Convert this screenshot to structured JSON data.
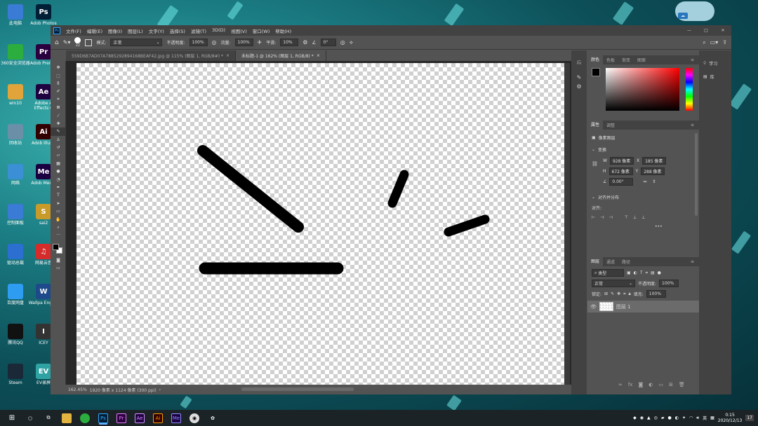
{
  "desktop": {
    "icons_col1": [
      {
        "label": "此电脑",
        "icon": "computer-icon",
        "color": "#3a7bd5"
      },
      {
        "label": "360安全浏览器",
        "icon": "browser-360-icon",
        "color": "#2cae3f"
      },
      {
        "label": "win10",
        "icon": "folder-user-icon",
        "color": "#e0a43a"
      },
      {
        "label": "回收站",
        "icon": "recycle-bin-icon",
        "color": "#6c8fa8"
      },
      {
        "label": "网络",
        "icon": "network-icon",
        "color": "#3a8fd5"
      },
      {
        "label": "控制面板",
        "icon": "control-panel-icon",
        "color": "#3a7bd5"
      },
      {
        "label": "驱动总裁",
        "icon": "driver-icon",
        "color": "#2b6fd1"
      },
      {
        "label": "百度网盘",
        "icon": "baidu-netdisk-icon",
        "color": "#2e9cf0"
      },
      {
        "label": "腾讯QQ",
        "icon": "qq-icon",
        "color": "#111"
      },
      {
        "label": "Steam",
        "icon": "steam-icon",
        "color": "#1b2838"
      }
    ],
    "icons_col2": [
      {
        "label": "Adob Photos",
        "icon": "photoshop-icon",
        "color": "#001e36",
        "glyph": "Ps"
      },
      {
        "label": "Adob Premie",
        "icon": "premiere-icon",
        "color": "#2a003f",
        "glyph": "Pr"
      },
      {
        "label": "Adobe A Effects C",
        "icon": "after-effects-icon",
        "color": "#1f0040",
        "glyph": "Ae"
      },
      {
        "label": "Adob Illustr",
        "icon": "illustrator-icon",
        "color": "#330000",
        "glyph": "Ai"
      },
      {
        "label": "Adob Media",
        "icon": "media-encoder-icon",
        "color": "#1a0040",
        "glyph": "Me"
      },
      {
        "label": "sai2",
        "icon": "sai-icon",
        "color": "#c79a2a",
        "glyph": "S"
      },
      {
        "label": "网易云音",
        "icon": "netease-music-icon",
        "color": "#d52b2b",
        "glyph": "♫"
      },
      {
        "label": "Wallpa Engine",
        "icon": "wallpaper-engine-icon",
        "color": "#1e4a8c",
        "glyph": "W"
      },
      {
        "label": "ICEY",
        "icon": "icey-icon",
        "color": "#333",
        "glyph": "I"
      },
      {
        "label": "EV录屏",
        "icon": "ev-recorder-icon",
        "color": "#2fa3a3",
        "glyph": "EV"
      }
    ]
  },
  "photoshop": {
    "app_icon": "Ps",
    "menu": [
      "文件(F)",
      "编辑(E)",
      "图像(I)",
      "图层(L)",
      "文字(Y)",
      "选择(S)",
      "滤镜(T)",
      "3D(D)",
      "视图(V)",
      "窗口(W)",
      "帮助(H)"
    ],
    "window_controls": [
      "—",
      "□",
      "✕"
    ],
    "options": {
      "brush_size": "22",
      "mode_label": "模式:",
      "mode_value": "正常",
      "opacity_label": "不透明度:",
      "opacity_value": "100%",
      "flow_label": "流量:",
      "flow_value": "100%",
      "smooth_label": "平滑:",
      "smooth_value": "10%",
      "angle_value": "0°"
    },
    "tabs": [
      {
        "label": "559D6B7AD07A7885292894168BEAF42.jpg @ 115% (图层 1, RGB/8#) *",
        "active": false
      },
      {
        "label": "未标题-1 @ 162% (图层 1, RGB/8) *",
        "active": true
      }
    ],
    "status": {
      "zoom": "162.45%",
      "doc_info": "1920 像素 x 1124 像素 (300 ppi)"
    },
    "color_panel": {
      "tabs": [
        "颜色",
        "色板",
        "渐变",
        "图案"
      ],
      "foreground": "#000000",
      "background": "#ffffff"
    },
    "properties_panel": {
      "tabs": [
        "属性",
        "调整"
      ],
      "type_label": "像素图层",
      "transform_title": "变换",
      "w_label": "W",
      "w_value": "928 像素",
      "h_label": "H",
      "h_value": "672 像素",
      "x_label": "X",
      "x_value": "185 像素",
      "y_label": "Y",
      "y_value": "288 像素",
      "angle_value": "0.00°",
      "align_title": "对齐并分布",
      "align_label": "对齐:",
      "more": "•••"
    },
    "layers_panel": {
      "tabs": [
        "图层",
        "通道",
        "路径"
      ],
      "filter_kind": "类型",
      "blend_mode": "正常",
      "opacity_label": "不透明度:",
      "opacity_value": "100%",
      "lock_label": "锁定:",
      "fill_label": "填充:",
      "fill_value": "100%",
      "layers": [
        {
          "name": "图层 1",
          "visible": true
        }
      ]
    },
    "right_strip": {
      "learn": "学习",
      "library": "库"
    }
  },
  "taskbar": {
    "apps": [
      "Ps",
      "Pr",
      "Ae",
      "Ai",
      "Me"
    ],
    "lang": "英",
    "time": "0:15",
    "date": "2020/12/13",
    "notification_count": "17"
  }
}
